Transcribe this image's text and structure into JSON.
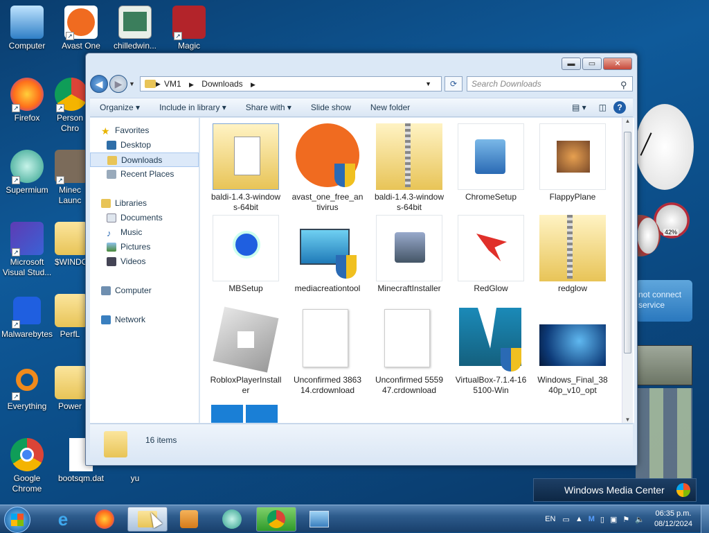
{
  "desktop_icons": [
    {
      "id": "computer",
      "label": "Computer"
    },
    {
      "id": "avast",
      "label": "Avast One"
    },
    {
      "id": "chilledwin",
      "label": "chilledwin..."
    },
    {
      "id": "magic",
      "label": "Magic"
    },
    {
      "id": "firefox",
      "label": "Firefox"
    },
    {
      "id": "chrome-profile",
      "label": "Person Chro"
    },
    {
      "id": "supermium",
      "label": "Supermium"
    },
    {
      "id": "minecraft",
      "label": "Minec Launc"
    },
    {
      "id": "vstudio",
      "label": "Microsoft Visual Stud..."
    },
    {
      "id": "windows-folder",
      "label": "$WINDO"
    },
    {
      "id": "malwarebytes",
      "label": "Malwarebytes"
    },
    {
      "id": "perfl",
      "label": "PerfL"
    },
    {
      "id": "everything",
      "label": "Everything"
    },
    {
      "id": "power",
      "label": "Power"
    },
    {
      "id": "google-chrome",
      "label": "Google Chrome"
    },
    {
      "id": "bootsqm",
      "label": "bootsqm.dat"
    },
    {
      "id": "yu",
      "label": "yu"
    }
  ],
  "gadgets": {
    "cpu_percent": "42%",
    "weather_msg": "not connect service",
    "media_center": "Windows Media Center"
  },
  "window": {
    "breadcrumb": [
      "VM1",
      "Downloads"
    ],
    "search_placeholder": "Search Downloads",
    "toolbar": [
      "Organize",
      "Include in library",
      "Share with",
      "Slide show",
      "New folder"
    ],
    "nav": {
      "favorites_label": "Favorites",
      "favorites": [
        "Desktop",
        "Downloads",
        "Recent Places"
      ],
      "libraries_label": "Libraries",
      "libraries": [
        "Documents",
        "Music",
        "Pictures",
        "Videos"
      ],
      "computer": "Computer",
      "network": "Network"
    },
    "files": [
      "baldi-1.4.3-windows-64bit",
      "avast_one_free_antivirus",
      "baldi-1.4.3-windows-64bit",
      "ChromeSetup",
      "FlappyPlane",
      "MBSetup",
      "mediacreationtool",
      "MinecraftInstaller",
      "RedGlow",
      "redglow",
      "RobloxPlayerInstaller",
      "Unconfirmed 386314.crdownload",
      "Unconfirmed 555947.crdownload",
      "VirtualBox-7.1.4-165100-Win",
      "Windows_Final_3840p_v10_opt"
    ],
    "status_count": "16 items"
  },
  "taskbar": {
    "lang": "EN",
    "time": "06:35 p.m.",
    "date": "08/12/2024"
  }
}
